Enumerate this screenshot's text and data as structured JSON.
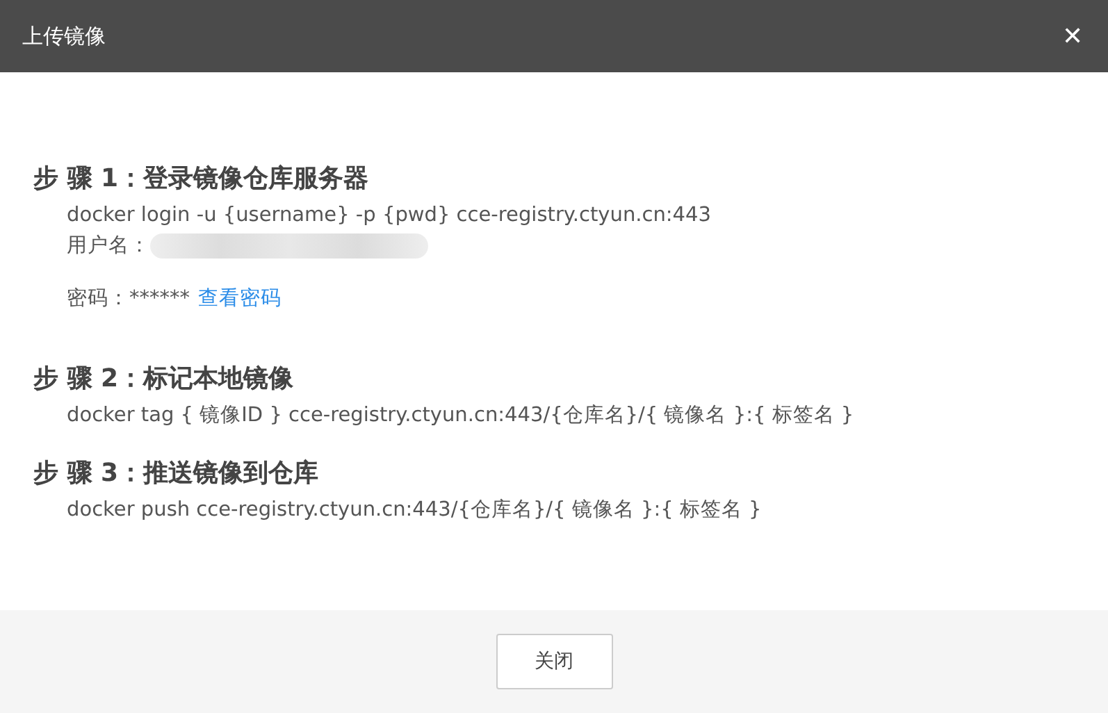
{
  "dialog": {
    "title": "上传镜像",
    "close_glyph": "✕"
  },
  "steps": [
    {
      "title": "步 骤 1：登录镜像仓库服务器",
      "lines": [
        {
          "kind": "command",
          "text": "docker login -u {username} -p {pwd} cce-registry.ctyun.cn:443"
        },
        {
          "kind": "redacted",
          "label": "用户名："
        },
        {
          "kind": "password",
          "label": "密码：",
          "value": "******",
          "link": "查看密码"
        }
      ]
    },
    {
      "title": "步 骤 2：标记本地镜像",
      "lines": [
        {
          "kind": "command",
          "text": "docker tag { 镜像ID } cce-registry.ctyun.cn:443/{仓库名}/{ 镜像名 }:{ 标签名 }"
        }
      ]
    },
    {
      "title": "步 骤 3：推送镜像到仓库",
      "lines": [
        {
          "kind": "command",
          "text": "docker push cce-registry.ctyun.cn:443/{仓库名}/{ 镜像名 }:{ 标签名 }"
        }
      ]
    }
  ],
  "footer": {
    "button": "关闭"
  }
}
